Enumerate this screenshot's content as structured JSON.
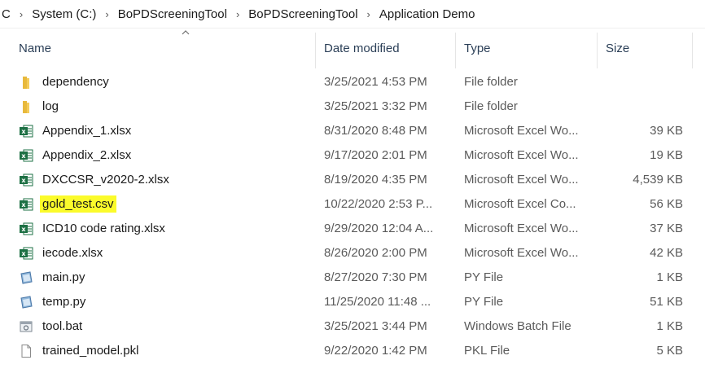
{
  "breadcrumb": [
    "C",
    "System (C:)",
    "BoPDScreeningTool",
    "BoPDScreeningTool",
    "Application Demo"
  ],
  "breadcrumb_separator": "›",
  "columns": {
    "name": "Name",
    "date": "Date modified",
    "type": "Type",
    "size": "Size"
  },
  "colors": {
    "highlight": "#fbfb2b",
    "folder": "#e8b93c",
    "excel": "#1d7044"
  },
  "files": [
    {
      "name": "dependency",
      "date": "3/25/2021 4:53 PM",
      "type": "File folder",
      "size": "",
      "icon": "folder-icon"
    },
    {
      "name": "log",
      "date": "3/25/2021 3:32 PM",
      "type": "File folder",
      "size": "",
      "icon": "folder-icon"
    },
    {
      "name": "Appendix_1.xlsx",
      "date": "8/31/2020 8:48 PM",
      "type": "Microsoft Excel Wo...",
      "size": "39 KB",
      "icon": "excel-icon"
    },
    {
      "name": "Appendix_2.xlsx",
      "date": "9/17/2020 2:01 PM",
      "type": "Microsoft Excel Wo...",
      "size": "19 KB",
      "icon": "excel-icon"
    },
    {
      "name": "DXCCSR_v2020-2.xlsx",
      "date": "8/19/2020 4:35 PM",
      "type": "Microsoft Excel Wo...",
      "size": "4,539 KB",
      "icon": "excel-icon"
    },
    {
      "name": "gold_test.csv",
      "date": "10/22/2020 2:53 P...",
      "type": "Microsoft Excel Co...",
      "size": "56 KB",
      "icon": "excel-csv-icon",
      "highlighted": true
    },
    {
      "name": "ICD10 code rating.xlsx",
      "date": "9/29/2020 12:04 A...",
      "type": "Microsoft Excel Wo...",
      "size": "37 KB",
      "icon": "excel-icon"
    },
    {
      "name": "iecode.xlsx",
      "date": "8/26/2020 2:00 PM",
      "type": "Microsoft Excel Wo...",
      "size": "42 KB",
      "icon": "excel-icon"
    },
    {
      "name": "main.py",
      "date": "8/27/2020 7:30 PM",
      "type": "PY File",
      "size": "1 KB",
      "icon": "python-file-icon"
    },
    {
      "name": "temp.py",
      "date": "11/25/2020 11:48 ...",
      "type": "PY File",
      "size": "51 KB",
      "icon": "python-file-icon"
    },
    {
      "name": "tool.bat",
      "date": "3/25/2021 3:44 PM",
      "type": "Windows Batch File",
      "size": "1 KB",
      "icon": "batch-file-icon"
    },
    {
      "name": "trained_model.pkl",
      "date": "9/22/2020 1:42 PM",
      "type": "PKL File",
      "size": "5 KB",
      "icon": "blank-file-icon"
    }
  ]
}
